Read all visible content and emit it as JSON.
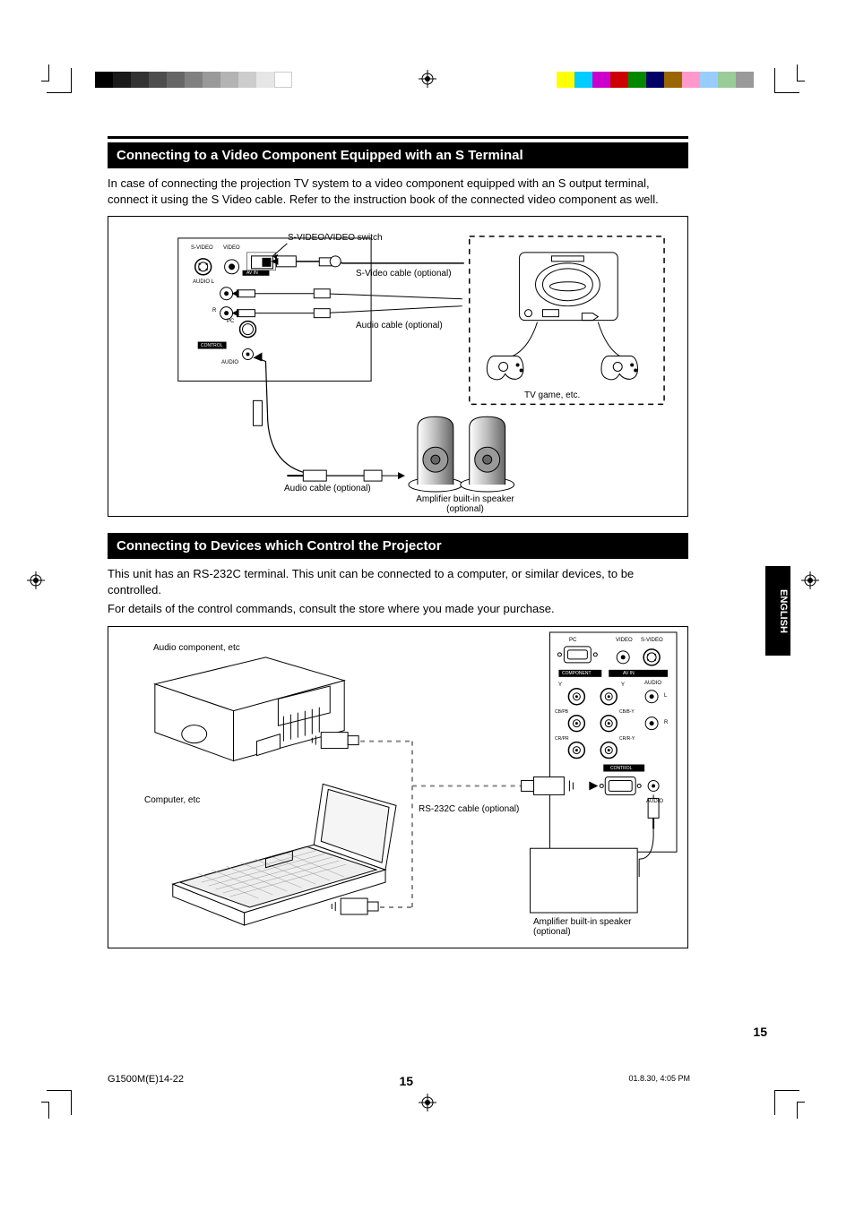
{
  "page_number": "15",
  "filename": "G1500M(E)14-22",
  "file_pagecount": "15",
  "timestamp": "01.8.30, 4:05 PM",
  "side_tab": "ENGLISH",
  "section1": {
    "heading": "Connecting to a Video Component Equipped with an S Terminal",
    "body": "In case of connecting the projection TV system to a video component equipped with an S output terminal, connect it using the S Video cable. Refer to the instruction book of the connected video component as well.",
    "diagram": {
      "switch_label": "S-VIDEO/VIDEO switch",
      "panel_svideo": "S-VIDEO",
      "panel_video": "VIDEO",
      "panel_av_in": "AV IN",
      "panel_audio_l": "AUDIO L",
      "panel_audio_r": "R",
      "panel_pc": "PC",
      "panel_control": "CONTROL",
      "panel_audio": "AUDIO",
      "source_box": "TV game, etc.",
      "cable_svideo": "S-Video cable (optional)",
      "cable_audio": "Audio cable (optional)",
      "cable_audio_out": "Audio cable (optional)",
      "amp_speaker": "Amplifier built-in speaker (optional)"
    }
  },
  "section2": {
    "heading": "Connecting to Devices which Control the Projector",
    "body1": "This unit has an RS-232C terminal. This unit can be connected to a computer, or similar devices, to be controlled.",
    "body2": "For details of the control commands, consult the store where you made your purchase.",
    "diagram": {
      "panel_svideo": "S-VIDEO",
      "panel_video": "VIDEO",
      "panel_avin": "AV IN",
      "panel_component": "COMPONENT",
      "panel_component_y": "Y",
      "panel_component_cb": "CB/B-Y",
      "panel_component_cr": "CR/R-Y",
      "panel_y": "Y",
      "panel_cb": "CB/PB",
      "panel_cr": "CR/PR",
      "panel_pc": "PC",
      "panel_audio": "AUDIO",
      "panel_l": "L",
      "panel_r": "R",
      "panel_control": "CONTROL",
      "device_a": "Audio component, etc",
      "device_b": "Computer, etc",
      "cable": "RS-232C cable (optional)",
      "amp_speaker": "Amplifier built-in speaker (optional)"
    }
  }
}
